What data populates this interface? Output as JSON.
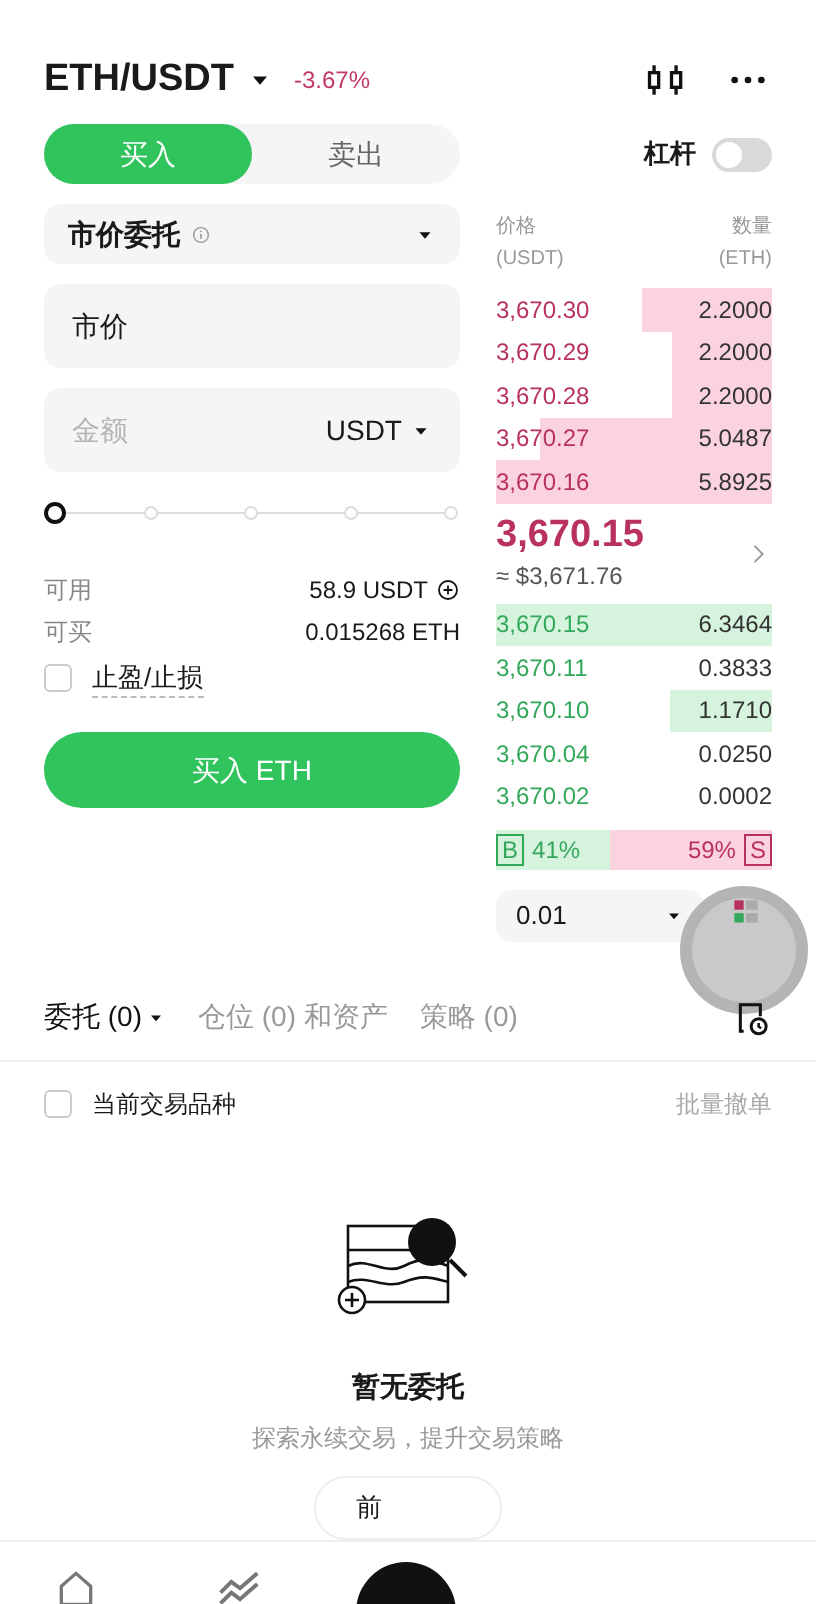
{
  "header": {
    "pair": "ETH/USDT",
    "change": "-3.67%"
  },
  "side_tabs": [
    {
      "label": "买入",
      "selected": true
    },
    {
      "label": "卖出",
      "selected": false
    }
  ],
  "leverage": {
    "label": "杠杆",
    "on": false
  },
  "order_type": "市价委托",
  "price_field": {
    "value": "市价"
  },
  "amount_field": {
    "placeholder": "金额",
    "unit": "USDT"
  },
  "amount_slider": {
    "level": 0
  },
  "available": {
    "label": "可用",
    "value": "58.9 USDT"
  },
  "can_buy": {
    "label": "可买",
    "value": "0.015268 ETH"
  },
  "tp_sl": {
    "label": "止盈/止损",
    "checked": false
  },
  "submit": "买入 ETH",
  "book_header": {
    "price": "价格",
    "price_unit": "(USDT)",
    "qty": "数量",
    "qty_unit": "(ETH)"
  },
  "asks": [
    {
      "price": "3,670.30",
      "qty": "2.2000"
    },
    {
      "price": "3,670.29",
      "qty": "2.2000"
    },
    {
      "price": "3,670.28",
      "qty": "2.2000"
    },
    {
      "price": "3,670.27",
      "qty": "5.0487"
    },
    {
      "price": "3,670.16",
      "qty": "5.8925"
    }
  ],
  "last_price": "3,670.15",
  "last_price_usd": "≈ $3,671.76",
  "bids": [
    {
      "price": "3,670.15",
      "qty": "6.3464"
    },
    {
      "price": "3,670.11",
      "qty": "0.3833"
    },
    {
      "price": "3,670.10",
      "qty": "1.1710"
    },
    {
      "price": "3,670.04",
      "qty": "0.0250"
    },
    {
      "price": "3,670.02",
      "qty": "0.0002"
    }
  ],
  "ratio": {
    "buy_label": "B",
    "buy": "41%",
    "sell": "59%",
    "sell_label": "S",
    "level": 0.41
  },
  "precision": "0.01",
  "bottom_tabs": [
    {
      "label": "委托 (0)",
      "selected": true
    },
    {
      "label": "仓位 (0) 和资产",
      "selected": false
    },
    {
      "label": "策略 (0)",
      "selected": false
    }
  ],
  "filter": {
    "label": "当前交易品种",
    "checked": false
  },
  "batch_cancel": "批量撤单",
  "empty": {
    "title": "暂无委托",
    "subtitle": "探索永续交易，提升交易策略",
    "button": "前"
  }
}
